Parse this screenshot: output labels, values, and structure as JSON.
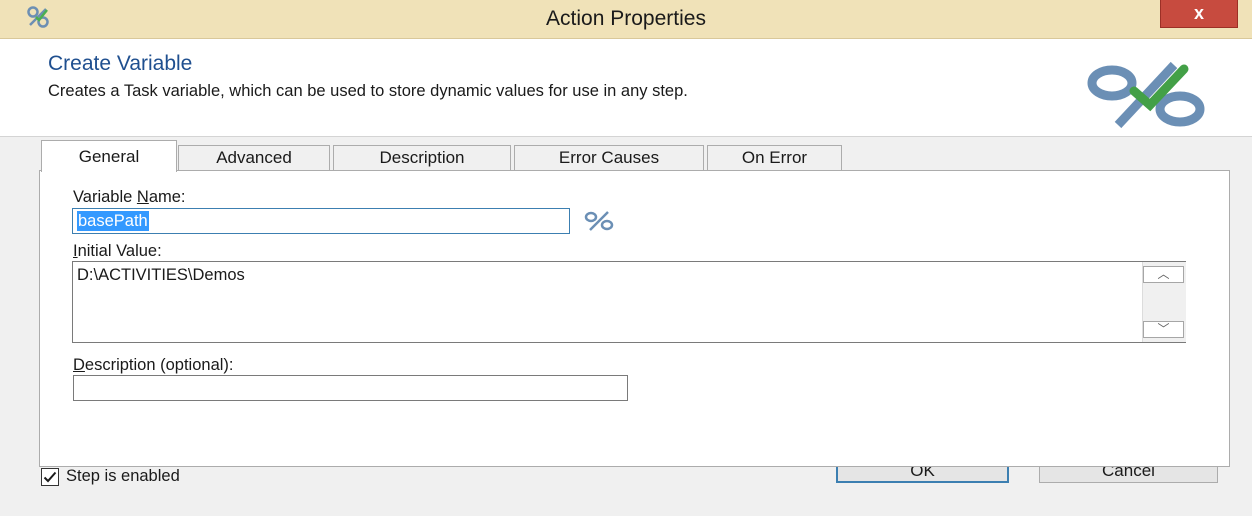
{
  "window": {
    "title": "Action Properties",
    "close_glyph": "x"
  },
  "header": {
    "title": "Create Variable",
    "description": "Creates a Task variable, which can be used to store dynamic values for use in any step.",
    "icon": "percent-check-icon"
  },
  "tabs": [
    {
      "label": "General",
      "active": true
    },
    {
      "label": "Advanced",
      "active": false
    },
    {
      "label": "Description",
      "active": false
    },
    {
      "label": "Error Causes",
      "active": false
    },
    {
      "label": "On Error",
      "active": false
    }
  ],
  "general": {
    "variable_name_label_pre": "Variable ",
    "variable_name_label_key": "N",
    "variable_name_label_post": "ame:",
    "variable_name_value": "basePath",
    "initial_value_label_key": "I",
    "initial_value_label_post": "nitial Value:",
    "initial_value": "D:\\ACTIVITIES\\Demos",
    "description_label_key": "D",
    "description_label_post": "escription (optional):",
    "description_value": ""
  },
  "footer": {
    "step_enabled_label": "Step is enabled",
    "step_enabled_checked": true,
    "ok_label": "OK",
    "cancel_label": "Cancel"
  },
  "colors": {
    "titlebar": "#f0e2b8",
    "close": "#c74b3f",
    "header_title": "#1f4f8f",
    "selection": "#3399ff"
  }
}
